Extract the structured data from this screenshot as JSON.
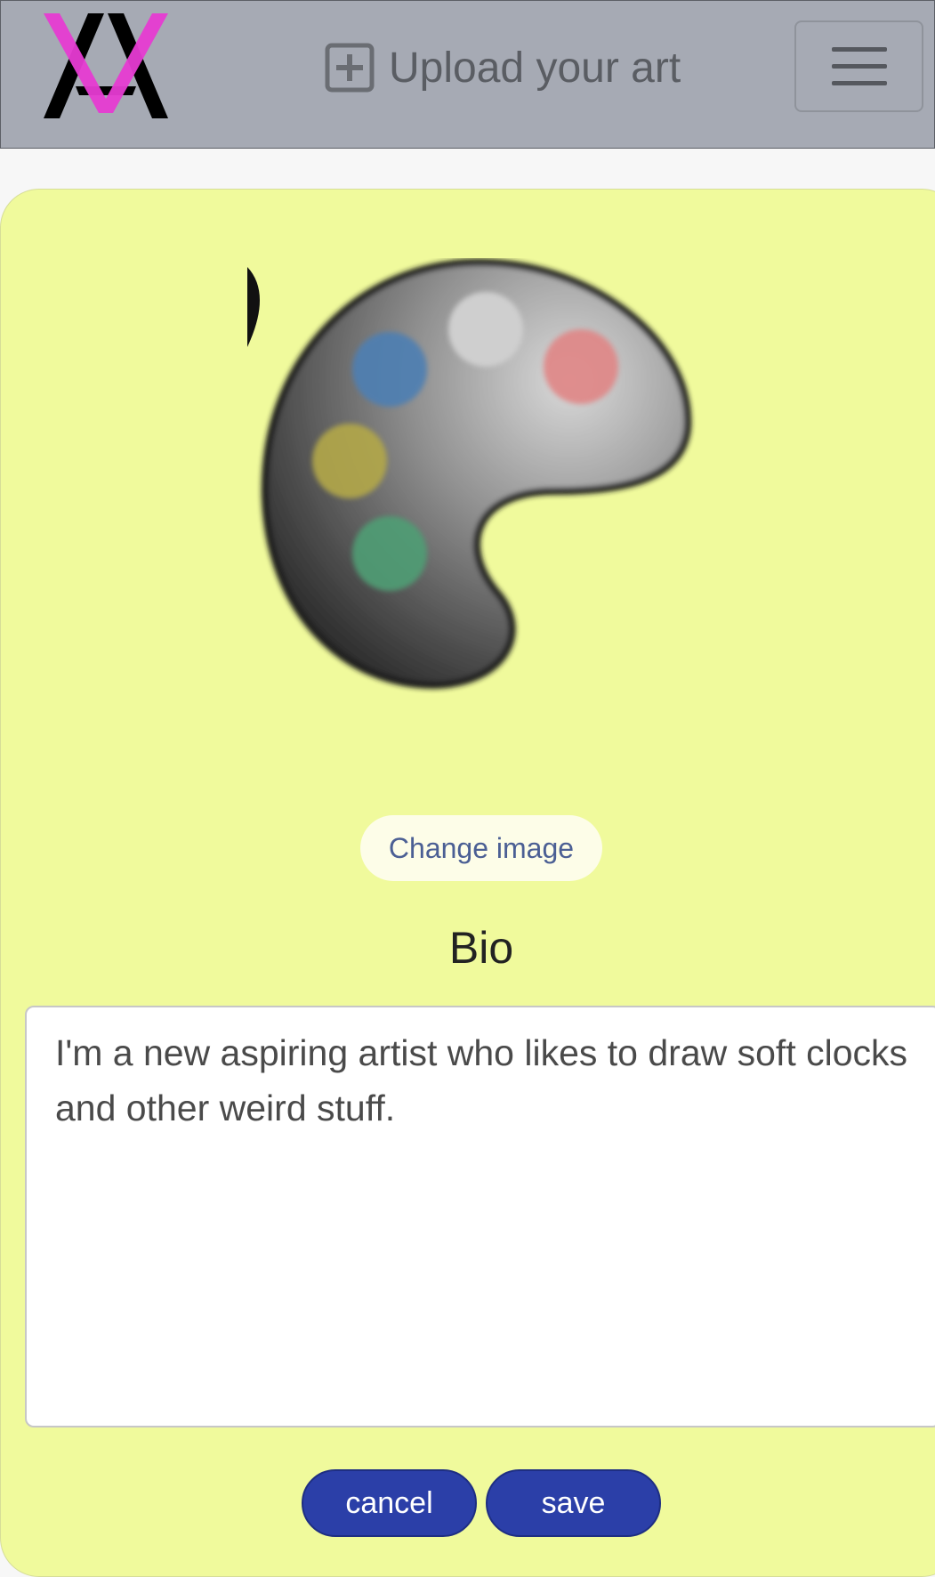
{
  "header": {
    "upload_label": "Upload your art",
    "logo_colors": {
      "primary": "#000000",
      "accent": "#e63bd2"
    }
  },
  "profile": {
    "change_image_label": "Change image",
    "bio_heading": "Bio",
    "bio_text": "I'm a new aspiring artist who likes to draw soft clocks and other weird stuff."
  },
  "actions": {
    "cancel_label": "cancel",
    "save_label": "save"
  },
  "colors": {
    "navbar": "#a6aab4",
    "card": "#f0fa9c",
    "button": "#2b3fa8"
  }
}
